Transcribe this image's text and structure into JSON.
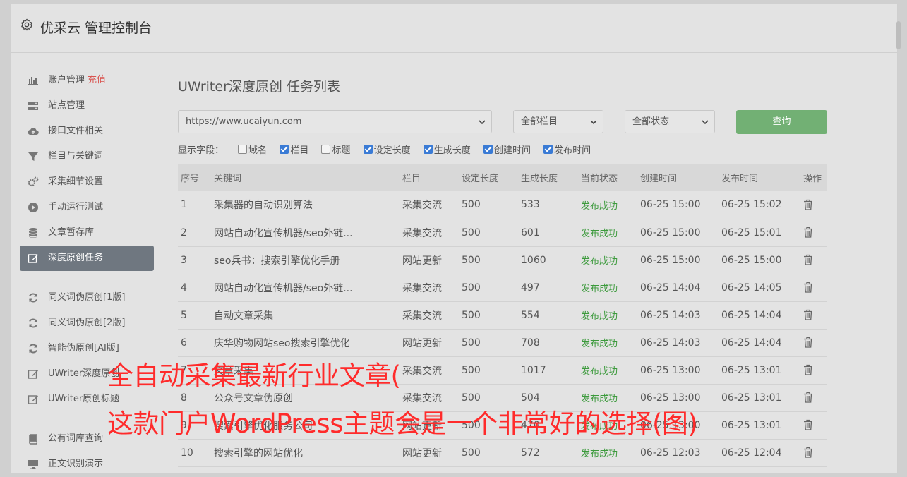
{
  "header": {
    "title": "优采云 管理控制台"
  },
  "sidebar": {
    "group1": [
      {
        "label": "账户管理",
        "badge": "充值",
        "icon": "bar-chart-icon"
      },
      {
        "label": "站点管理",
        "icon": "server-icon"
      },
      {
        "label": "接口文件相关",
        "icon": "cloud-upload-icon"
      },
      {
        "label": "栏目与关键词",
        "icon": "filter-icon"
      },
      {
        "label": "采集细节设置",
        "icon": "gears-icon"
      },
      {
        "label": "手动运行测试",
        "icon": "play-icon"
      },
      {
        "label": "文章暂存库",
        "icon": "database-icon"
      },
      {
        "label": "深度原创任务",
        "icon": "edit-icon",
        "active": true
      }
    ],
    "group2": [
      {
        "label": "同义词伪原创[1版]",
        "icon": "refresh-icon"
      },
      {
        "label": "同义词伪原创[2版]",
        "icon": "refresh-icon"
      },
      {
        "label": "智能伪原创[AI版]",
        "icon": "refresh-icon"
      },
      {
        "label": "UWriter深度原创",
        "icon": "edit-icon"
      },
      {
        "label": "UWriter原创标题",
        "icon": "edit-icon"
      }
    ],
    "group3": [
      {
        "label": "公有词库查询",
        "icon": "book-icon"
      },
      {
        "label": "正文识别演示",
        "icon": "monitor-icon"
      }
    ]
  },
  "main": {
    "title": "UWriter深度原创 任务列表",
    "site_select": "https://www.ucaiyun.com",
    "column_select": "全部栏目",
    "status_select": "全部状态",
    "query_label": "查询",
    "fields_label": "显示字段：",
    "fields": [
      {
        "label": "域名",
        "checked": false
      },
      {
        "label": "栏目",
        "checked": true
      },
      {
        "label": "标题",
        "checked": false
      },
      {
        "label": "设定长度",
        "checked": true
      },
      {
        "label": "生成长度",
        "checked": true
      },
      {
        "label": "创建时间",
        "checked": true
      },
      {
        "label": "发布时间",
        "checked": true
      }
    ],
    "columns": [
      "序号",
      "关键词",
      "栏目",
      "设定长度",
      "生成长度",
      "当前状态",
      "创建时间",
      "发布时间",
      "操作"
    ],
    "rows": [
      [
        "1",
        "采集器的自动识别算法",
        "采集交流",
        "500",
        "533",
        "发布成功",
        "06-25 15:00",
        "06-25 15:02"
      ],
      [
        "2",
        "网站自动化宣传机器/seo外链...",
        "采集交流",
        "500",
        "601",
        "发布成功",
        "06-25 15:00",
        "06-25 15:01"
      ],
      [
        "3",
        "seo兵书：搜索引擎优化手册",
        "网站更新",
        "500",
        "1060",
        "发布成功",
        "06-25 15:00",
        "06-25 15:00"
      ],
      [
        "4",
        "网站自动化宣传机器/seo外链...",
        "采集交流",
        "500",
        "497",
        "发布成功",
        "06-25 14:04",
        "06-25 14:05"
      ],
      [
        "5",
        "自动文章采集",
        "采集交流",
        "500",
        "554",
        "发布成功",
        "06-25 14:03",
        "06-25 14:04"
      ],
      [
        "6",
        "庆华购物网站seo搜索引擎优化",
        "网站更新",
        "500",
        "708",
        "发布成功",
        "06-25 14:03",
        "06-25 14:04"
      ],
      [
        "7",
        "文章采集",
        "采集交流",
        "500",
        "1017",
        "发布成功",
        "06-25 13:00",
        "06-25 13:01"
      ],
      [
        "8",
        "公众号文章伪原创",
        "采集交流",
        "500",
        "504",
        "发布成功",
        "06-25 13:00",
        "06-25 13:01"
      ],
      [
        "9",
        "搜索引擎优化服务公司",
        "网站更新",
        "500",
        "470",
        "发布成功",
        "06-25 13:00",
        "06-25 13:01"
      ],
      [
        "10",
        "搜索引擎的网站优化",
        "网站更新",
        "500",
        "572",
        "发布成功",
        "06-25 12:03",
        "06-25 12:04"
      ]
    ]
  },
  "overlay": {
    "line1": "全自动采集最新行业文章(",
    "line2": "这款门户WordPress主题会是一个非常好的选择(图)"
  },
  "colors": {
    "accent": "#72b074",
    "success": "#3c9a3c",
    "badge": "#d9534f",
    "overlay": "#ff2b2b",
    "active_bg": "#6f7780"
  }
}
